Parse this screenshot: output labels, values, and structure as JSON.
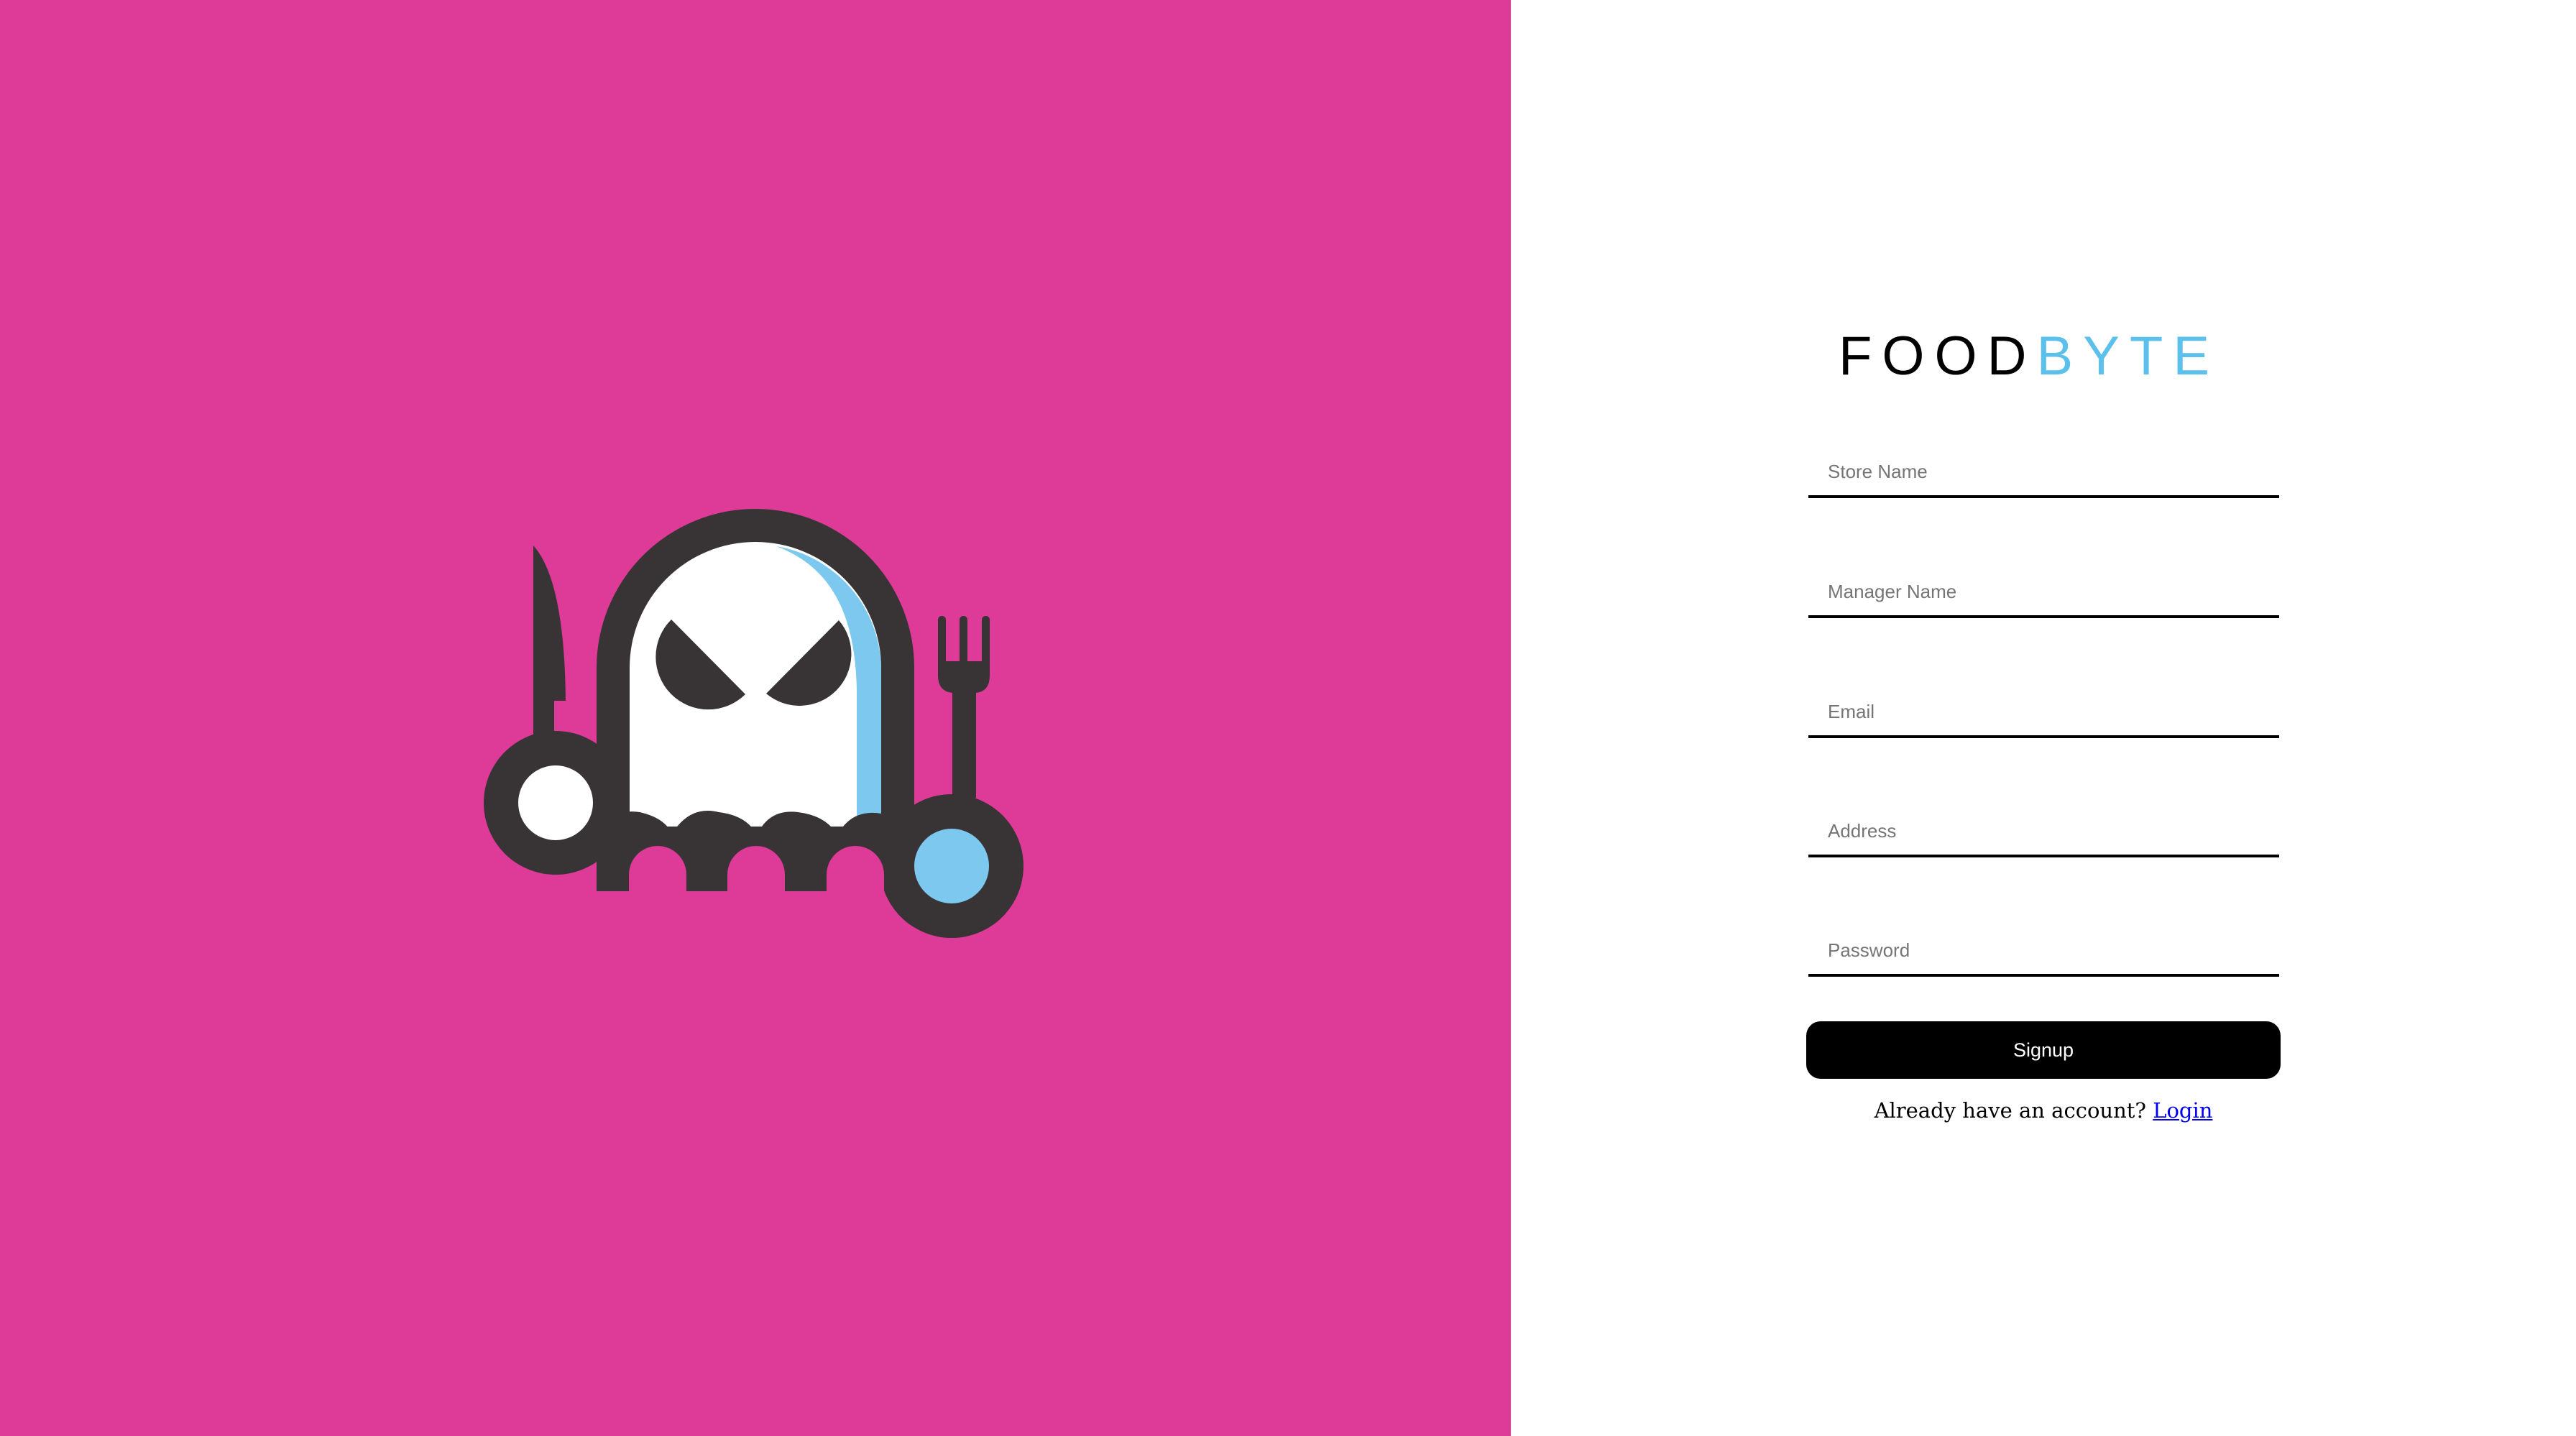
{
  "brand": {
    "part1": "FOOD",
    "part2": "BYTE",
    "colors": {
      "part1": "#000000",
      "part2": "#5BC0EB"
    }
  },
  "hero": {
    "background": "#DE3A97",
    "mascot": "ghost-with-knife-and-fork-logo",
    "colors": {
      "outline": "#383436",
      "body": "#FFFFFF",
      "shade": "#7CC8EF"
    }
  },
  "form": {
    "fields": [
      {
        "name": "store-name",
        "placeholder": "Store Name",
        "value": ""
      },
      {
        "name": "manager-name",
        "placeholder": "Manager Name",
        "value": ""
      },
      {
        "name": "email",
        "placeholder": "Email",
        "value": ""
      },
      {
        "name": "address",
        "placeholder": "Address",
        "value": ""
      },
      {
        "name": "password",
        "placeholder": "Password",
        "value": ""
      }
    ],
    "submit_label": "Signup",
    "footer_text": "Already have an account?",
    "login_link": "Login"
  }
}
